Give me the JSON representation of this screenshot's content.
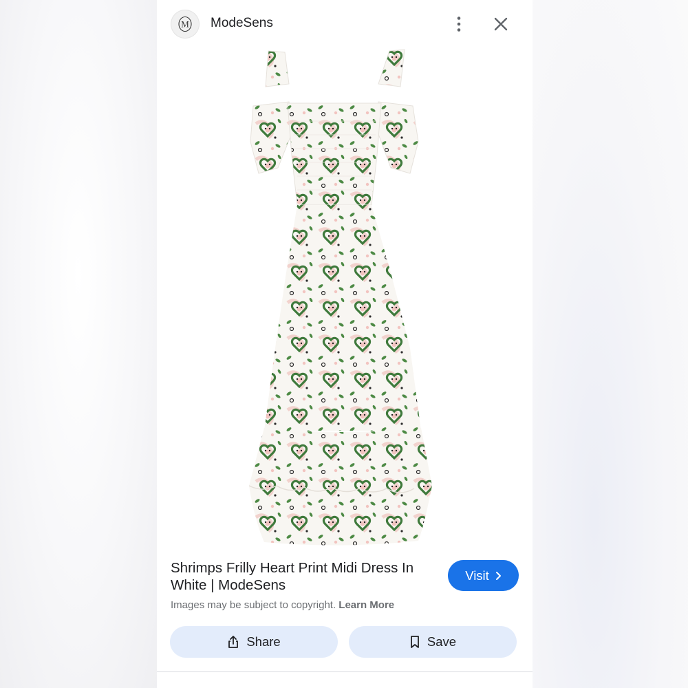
{
  "header": {
    "logo_letter": "M",
    "site_name": "ModeSens",
    "more_icon": "more-vertical-icon",
    "close_icon": "close-icon"
  },
  "product": {
    "title": "Shrimps Frilly Heart Print Midi Dress In White | ModeSens",
    "image_icon": "dress-photo"
  },
  "copyright": {
    "text": "Images may be subject to copyright.",
    "link": "Learn More"
  },
  "actions": {
    "visit_label": "Visit",
    "share_label": "Share",
    "save_label": "Save"
  },
  "colors": {
    "accent": "#1a73e8",
    "chip_bg": "#e3ecfb",
    "dress_green": "#3f7a3c",
    "dress_pink": "#f2c4c0"
  }
}
